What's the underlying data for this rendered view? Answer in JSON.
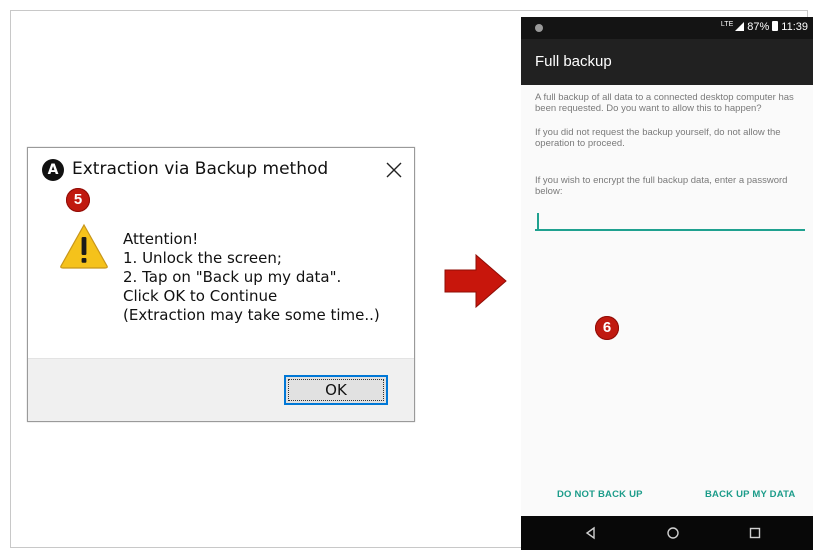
{
  "dialog": {
    "title": "Extraction via Backup method",
    "app_icon_letter": "A",
    "step_badge": "5",
    "message_lines": [
      "Attention!",
      "1. Unlock the screen;",
      "2. Tap on \"Back up my data\".",
      "Click OK to Continue",
      "(Extraction may take some time..)"
    ],
    "ok_label": "OK"
  },
  "phone": {
    "status": {
      "network": "LTE",
      "battery": "87%",
      "time": "11:39"
    },
    "app_bar_title": "Full backup",
    "paragraphs": [
      "A full backup of all data to a connected desktop computer has been requested. Do you want to allow this to happen?",
      "If you did not request the backup yourself, do not allow the operation to proceed.",
      "If you wish to encrypt the full backup data, enter a password below:"
    ],
    "step_badge": "6",
    "deny_label": "DO NOT BACK UP",
    "allow_label": "BACK UP MY DATA"
  },
  "colors": {
    "badge": "#c0190f",
    "arrow": "#c8160c",
    "accent": "#1c9c8a",
    "focus": "#0078d7"
  },
  "icons": [
    "app-logo-icon",
    "close-icon",
    "warning-icon",
    "arrow-right-icon",
    "signal-icon",
    "battery-icon",
    "back-icon",
    "home-icon",
    "recents-icon"
  ]
}
